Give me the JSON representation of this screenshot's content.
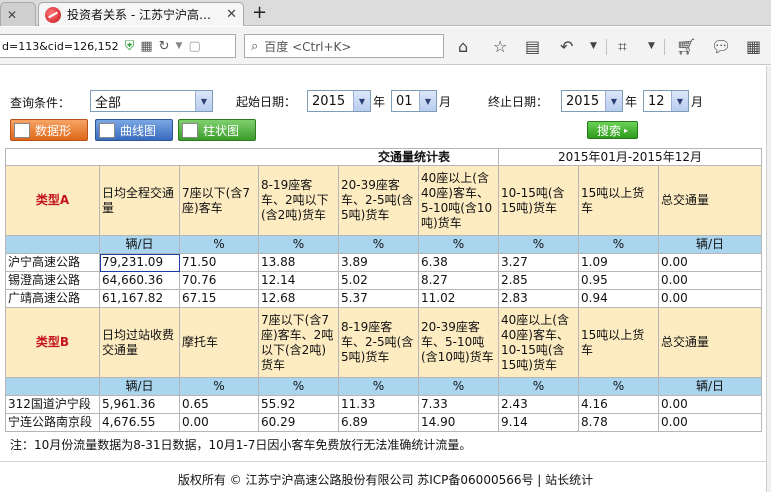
{
  "browser": {
    "tab1_title": "",
    "tab2_title": "投资者关系 - 江苏宁沪高…",
    "new_tab": "+",
    "close": "✕",
    "url": "d=113&cid=126,152",
    "search_placeholder": "百度 <Ctrl+K>"
  },
  "form": {
    "query_label": "查询条件：",
    "query_value": "全部",
    "start_label": "起始日期：",
    "start_year": "2015",
    "year_unit": "年",
    "start_month": "01",
    "month_unit": "月",
    "end_label": "终止日期：",
    "end_year": "2015",
    "end_month": "12",
    "btn_data": "数据形",
    "btn_line": "曲线图",
    "btn_bar": "柱状图",
    "btn_search": "搜索"
  },
  "table": {
    "title": "交通量统计表",
    "period": "2015年01月-2015年12月",
    "groupA": {
      "type": "类型A",
      "headers": [
        "日均全程交通量",
        "7座以下(含7座)客车",
        "8-19座客车、2吨以下(含2吨)货车",
        "20-39座客车、2-5吨(含5吨)货车",
        "40座以上(含40座)客车、5-10吨(含10吨)货车",
        "10-15吨(含15吨)货车",
        "15吨以上货车",
        "总交通量"
      ],
      "units": [
        "辆/日",
        "%",
        "%",
        "%",
        "%",
        "%",
        "%",
        "辆/日"
      ],
      "rows": [
        [
          "沪宁高速公路",
          "79,231.09",
          "71.50",
          "13.88",
          "3.89",
          "6.38",
          "3.27",
          "1.09",
          "0.00"
        ],
        [
          "锡澄高速公路",
          "64,660.36",
          "70.76",
          "12.14",
          "5.02",
          "8.27",
          "2.85",
          "0.95",
          "0.00"
        ],
        [
          "广靖高速公路",
          "61,167.82",
          "67.15",
          "12.68",
          "5.37",
          "11.02",
          "2.83",
          "0.94",
          "0.00"
        ]
      ]
    },
    "groupB": {
      "type": "类型B",
      "headers": [
        "日均过站收费交通量",
        "摩托车",
        "7座以下(含7座)客车、2吨以下(含2吨)货车",
        "8-19座客车、2-5吨(含5吨)货车",
        "20-39座客车、5-10吨(含10吨)货车",
        "40座以上(含40座)客车、10-15吨(含15吨)货车",
        "15吨以上货车",
        "总交通量"
      ],
      "units": [
        "辆/日",
        "%",
        "%",
        "%",
        "%",
        "%",
        "%",
        "辆/日"
      ],
      "rows": [
        [
          "312国道沪宁段",
          "5,961.36",
          "0.65",
          "55.92",
          "11.33",
          "7.33",
          "2.43",
          "4.16",
          "0.00"
        ],
        [
          "宁连公路南京段",
          "4,676.55",
          "0.00",
          "60.29",
          "6.89",
          "14.90",
          "9.14",
          "8.78",
          "0.00"
        ]
      ]
    }
  },
  "note": "注：10月份流量数据为8-31日数据，10月1-7日因小客车免费放行无法准确统计流量。",
  "footer": "版权所有 © 江苏宁沪高速公路股份有限公司 苏ICP备06000566号 | 站长统计"
}
